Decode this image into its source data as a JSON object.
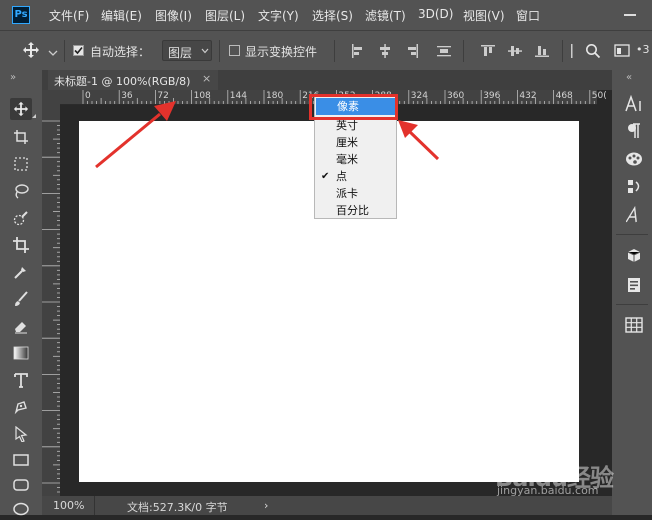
{
  "menubar": {
    "logo": "Ps",
    "items": [
      "文件(F)",
      "编辑(E)",
      "图像(I)",
      "图层(L)",
      "文字(Y)",
      "选择(S)",
      "滤镜(T)",
      "3D(D)",
      "视图(V)",
      "窗口"
    ]
  },
  "options": {
    "auto_select_label": "自动选择：",
    "layer_select_value": "图层",
    "show_transform_label": "显示变换控件",
    "overflow_text": "•3"
  },
  "document": {
    "tab_title": "未标题-1 @ 100%(RGB/8)",
    "tab_close": "×"
  },
  "ruler": {
    "labels": [
      "0",
      "36",
      "72",
      "108",
      "144",
      "180",
      "216",
      "252",
      "288",
      "324",
      "360",
      "396",
      "432",
      "468",
      "50("
    ]
  },
  "dropdown": {
    "items": [
      "像素",
      "英寸",
      "厘米",
      "毫米",
      "点",
      "派卡",
      "百分比"
    ],
    "selected": "像素",
    "checked": "点",
    "check_mark": "✔"
  },
  "status": {
    "zoom": "100%",
    "doc_info": "文档:527.3K/0 字节",
    "arrow": "›"
  },
  "watermark": {
    "logo": "Baidu经验",
    "url": "jingyan.baidu.com"
  },
  "colors": {
    "annotation_red": "#e3322c",
    "menu_selection": "#3a8ee6",
    "panel_gray": "#535353",
    "workspace": "#282828"
  }
}
